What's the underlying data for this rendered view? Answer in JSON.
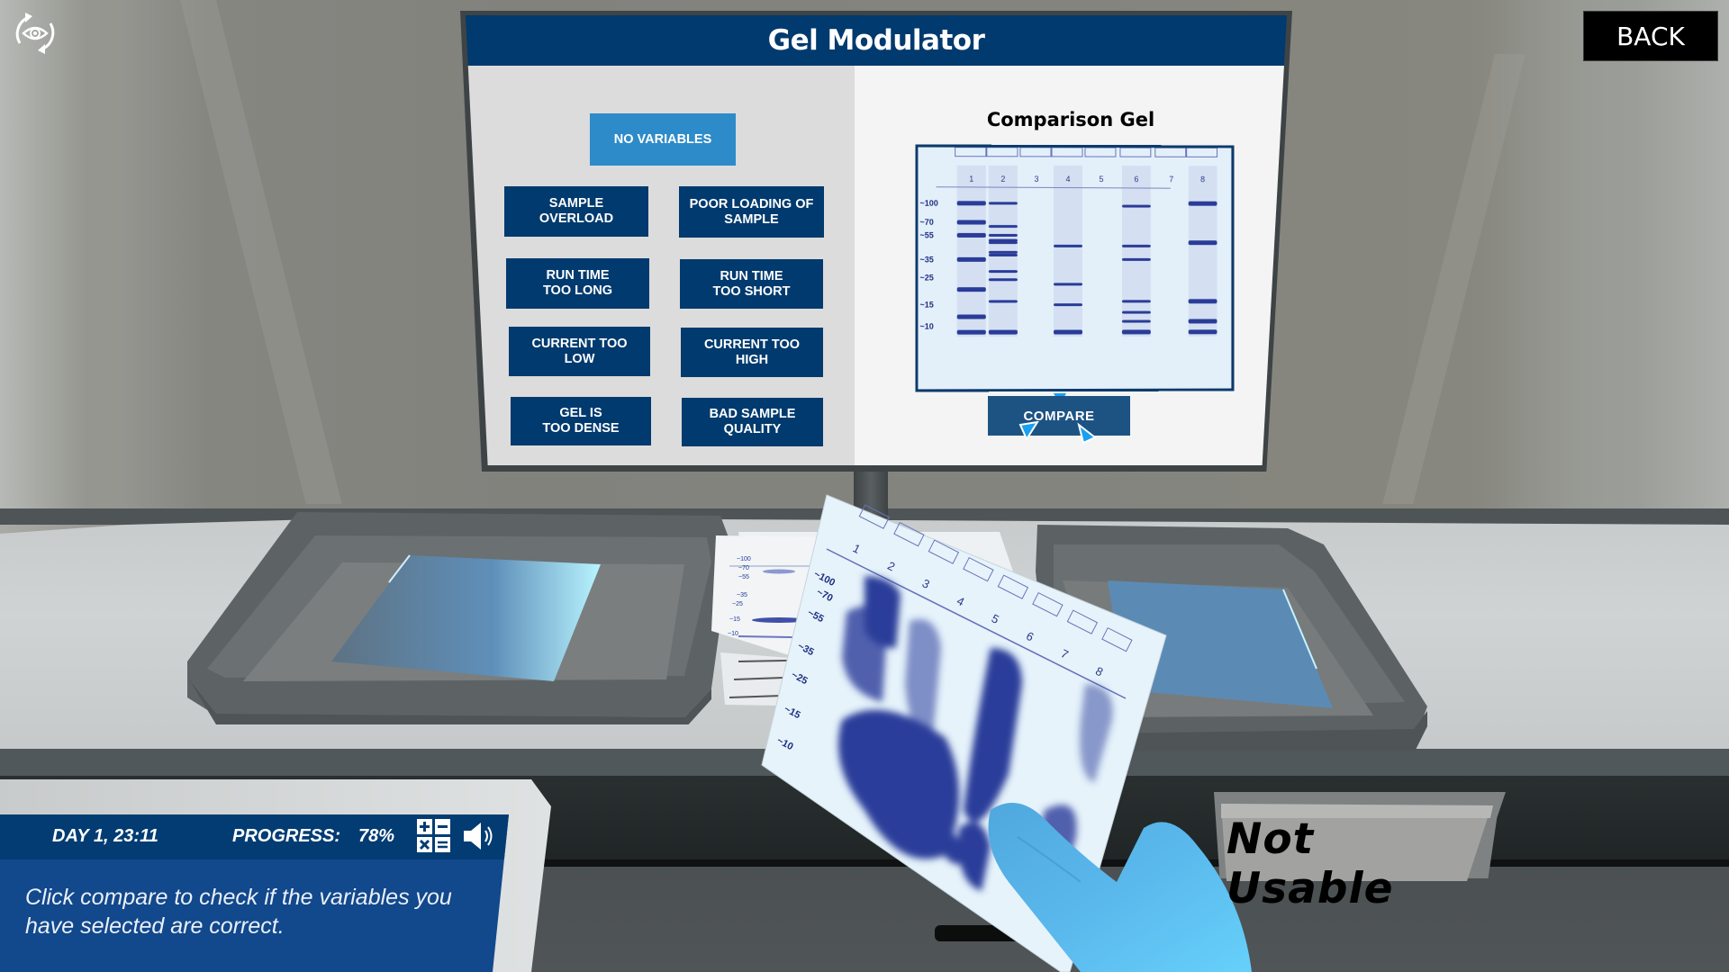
{
  "app": {
    "screen_title": "Gel Modulator",
    "back_label": "BACK"
  },
  "variables": {
    "no_variables": "NO VARIABLES",
    "options": [
      {
        "label_line1": "SAMPLE",
        "label_line2": "OVERLOAD"
      },
      {
        "label_line1": "POOR LOADING OF",
        "label_line2": "SAMPLE"
      },
      {
        "label_line1": "RUN TIME",
        "label_line2": "TOO LONG"
      },
      {
        "label_line1": "RUN TIME",
        "label_line2": "TOO SHORT"
      },
      {
        "label_line1": "CURRENT TOO",
        "label_line2": "LOW"
      },
      {
        "label_line1": "CURRENT TOO",
        "label_line2": "HIGH"
      },
      {
        "label_line1": "GEL IS",
        "label_line2": "TOO DENSE"
      },
      {
        "label_line1": "BAD SAMPLE",
        "label_line2": "QUALITY"
      }
    ],
    "selected": "NO VARIABLES"
  },
  "comparison": {
    "title": "Comparison Gel",
    "compare_label": "COMPARE",
    "lanes": [
      "1",
      "2",
      "3",
      "4",
      "5",
      "6",
      "7",
      "8"
    ],
    "markers": [
      "~100",
      "~70",
      "~55",
      "~35",
      "~25",
      "~15",
      "~10"
    ],
    "bands": {
      "1": [
        100,
        70,
        55,
        35,
        20,
        12,
        9
      ],
      "2": [
        100,
        65,
        55,
        50,
        48,
        40,
        38,
        28,
        24,
        16,
        9
      ],
      "3": [],
      "4": [
        45,
        22,
        15,
        9
      ],
      "5": [],
      "6": [
        95,
        45,
        35,
        16,
        13,
        11,
        9
      ],
      "7": [],
      "8": [
        100,
        48,
        16,
        11,
        9
      ]
    }
  },
  "hud": {
    "day_time": "DAY 1, 23:11",
    "progress_label": "PROGRESS:",
    "progress_value": "78%",
    "progress_fraction": 0.78,
    "message": "Click compare to check if the variables you have selected are correct.",
    "icons": [
      "calculator-icon",
      "speaker-icon"
    ]
  },
  "scene": {
    "sign_text": "Not Usable",
    "held_gel_lanes": [
      "1",
      "2",
      "3",
      "4",
      "5",
      "6",
      "7",
      "8"
    ],
    "held_gel_markers": [
      "~100",
      "~70",
      "~55",
      "~35",
      "~25",
      "~15",
      "~10"
    ],
    "paper_markers": [
      "~100",
      "~70",
      "~55",
      "~35",
      "~25",
      "~15",
      "~10"
    ]
  },
  "colors": {
    "primary_navy": "#013a6e",
    "selected_blue": "#2e8bc9",
    "band_blue": "#2a3c98",
    "glove_blue": "#5ab8ec"
  }
}
